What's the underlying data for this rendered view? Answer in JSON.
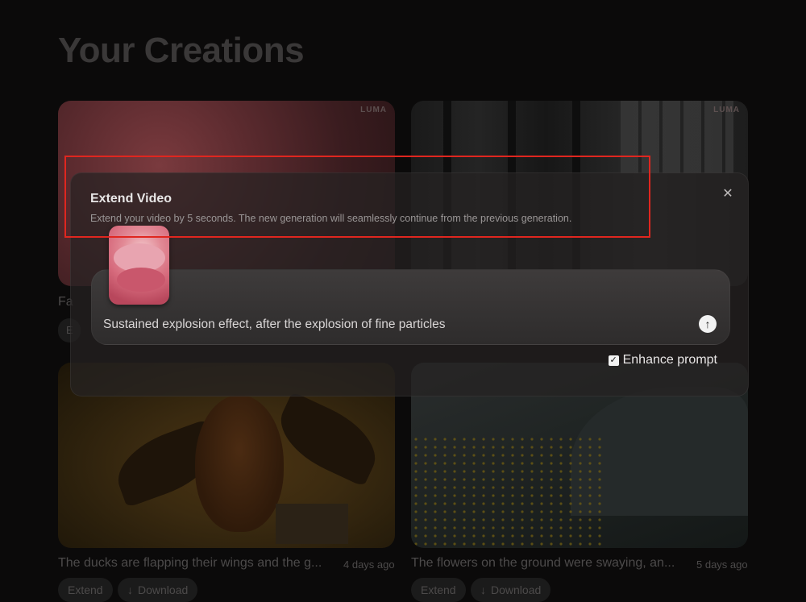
{
  "page": {
    "title": "Your Creations"
  },
  "watermark": "LUMA",
  "cards": [
    {
      "caption": "",
      "age": "",
      "extend_label": "",
      "download_label": ""
    },
    {
      "caption": "",
      "age": "",
      "extend_label": "",
      "download_label": ""
    },
    {
      "caption": "The ducks are flapping their wings and the g...",
      "age": "4 days ago",
      "extend_label": "Extend",
      "download_label": "Download"
    },
    {
      "caption": "The flowers on the ground were swaying, an...",
      "age": "5 days ago",
      "extend_label": "Extend",
      "download_label": "Download"
    }
  ],
  "partial_caption_fragment": "Fa",
  "partial_chip_fragment": "E",
  "modal": {
    "title": "Extend Video",
    "description": "Extend your video by 5 seconds. The new generation will seamlessly continue from the previous generation.",
    "close_icon": "✕",
    "prompt_value": "Sustained explosion effect, after the explosion of fine particles",
    "send_icon": "↑",
    "enhance_label": "Enhance prompt",
    "enhance_checked": true,
    "checkbox_glyph": "✓"
  },
  "icons": {
    "download": "↓"
  },
  "colors": {
    "highlight": "#e0261f",
    "background": "#0b0a0a"
  }
}
